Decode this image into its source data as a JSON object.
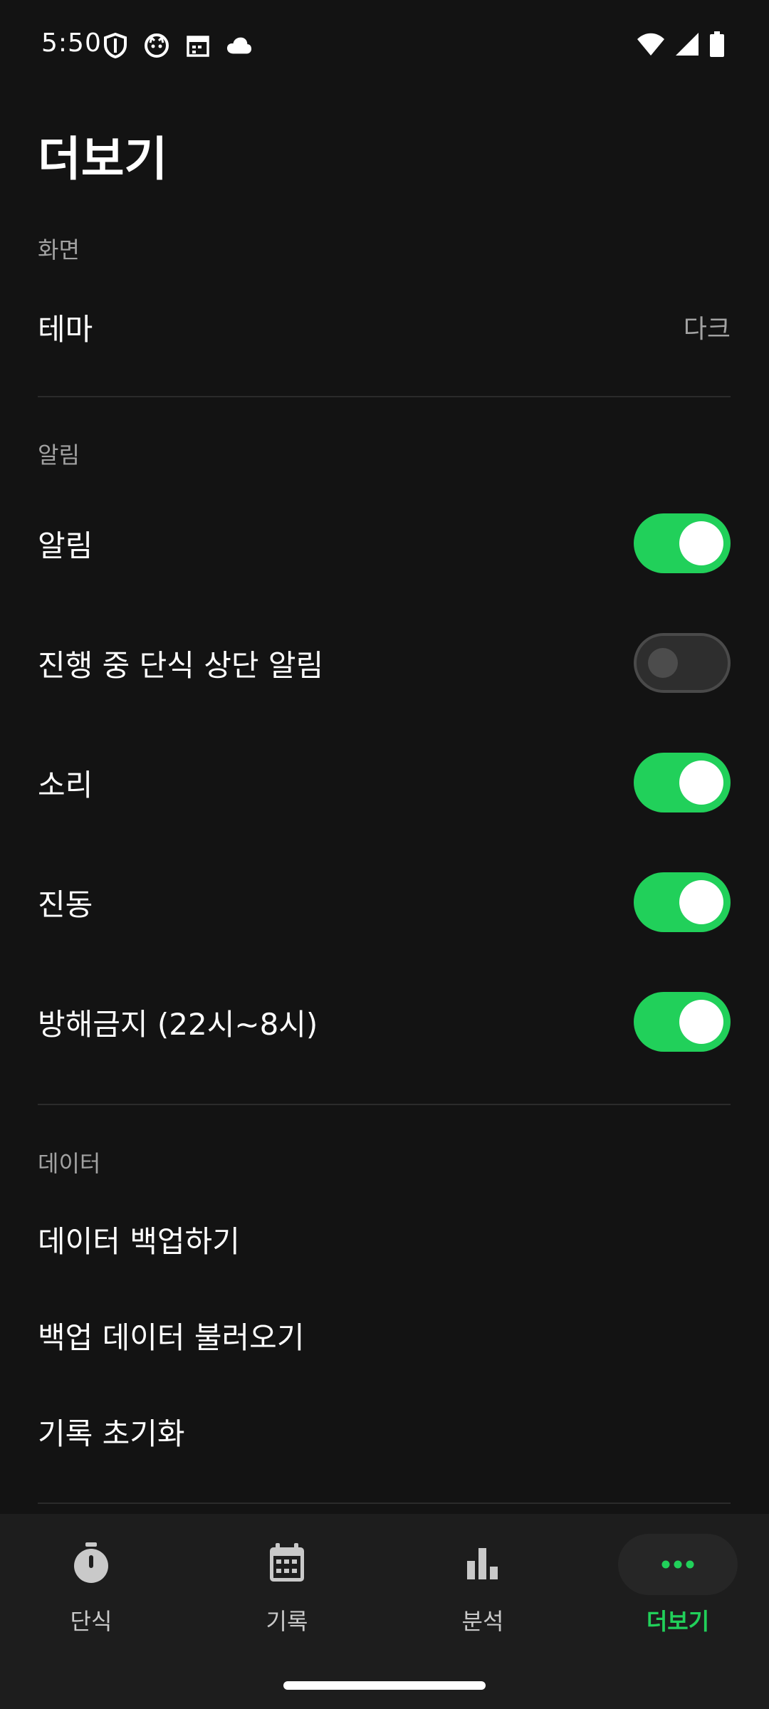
{
  "status_bar": {
    "time": "5:50",
    "left_icons": [
      "shield-icon",
      "cat-face-icon",
      "calendar-icon",
      "cloud-icon"
    ],
    "right_icons": [
      "wifi-icon",
      "signal-icon",
      "battery-icon"
    ]
  },
  "header": {
    "title": "더보기"
  },
  "sections": {
    "display": {
      "header": "화면",
      "theme_label": "테마",
      "theme_value": "다크"
    },
    "notifications": {
      "header": "알림",
      "items": [
        {
          "label": "알림",
          "enabled": true
        },
        {
          "label": "진행 중 단식 상단 알림",
          "enabled": false
        },
        {
          "label": "소리",
          "enabled": true
        },
        {
          "label": "진동",
          "enabled": true
        },
        {
          "label": "방해금지 (22시~8시)",
          "enabled": true
        }
      ]
    },
    "data": {
      "header": "데이터",
      "items": [
        {
          "label": "데이터 백업하기"
        },
        {
          "label": "백업 데이터 불러오기"
        },
        {
          "label": "기록 초기화"
        }
      ]
    }
  },
  "bottom_nav": {
    "items": [
      {
        "label": "단식",
        "icon": "stopwatch-icon",
        "active": false
      },
      {
        "label": "기록",
        "icon": "calendar-icon",
        "active": false
      },
      {
        "label": "분석",
        "icon": "bar-chart-icon",
        "active": false
      },
      {
        "label": "더보기",
        "icon": "more-dots-icon",
        "active": true
      }
    ]
  },
  "colors": {
    "background": "#131313",
    "accent": "#21d05a",
    "secondary_text": "#a2a2a2",
    "nav_background": "#1d1d1d"
  }
}
